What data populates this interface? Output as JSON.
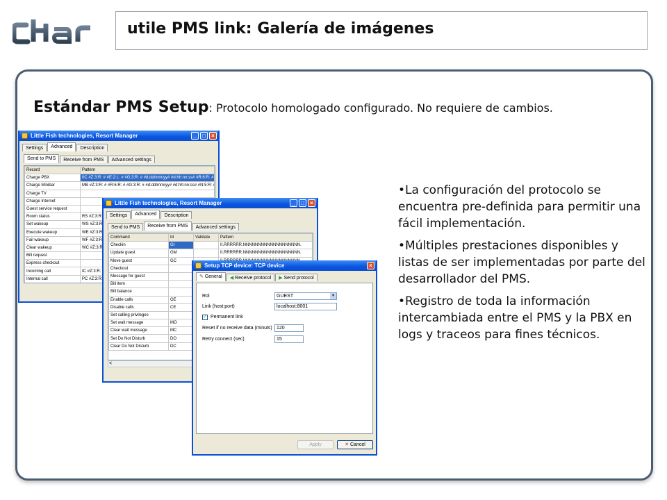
{
  "slide": {
    "title": "utile PMS link: Galería de imágenes",
    "heading_bold": "Estándar PMS Setup",
    "heading_rest": ": Protocolo homologado configurado. No requiere de cambios.",
    "bullets": [
      "•La configuración del protocolo se encuentra pre-definida para permitir una fácil implementación.",
      "•Múltiples prestaciones disponibles y listas de ser implementadas por parte del desarrollador del PMS.",
      "•Registro de toda la información intercambiada entre el PMS y la PBX en logs y traceos para fines técnicos."
    ]
  },
  "win1": {
    "title": "Little Fish technologies, Resort Manager",
    "tabs": [
      "Settings",
      "Advanced",
      "Description"
    ],
    "subtabs": [
      "Send to PMS",
      "Receive from PMS",
      "Advanced settings"
    ],
    "headers": [
      "Record",
      "Pattern"
    ],
    "rows": [
      [
        "Charge PBX",
        "0C #Z:3:R: # #E:2:L: # #G:3:R: # #d:dd/mm/yy# #d:hh:nn:ss# #R:6:R: #"
      ],
      [
        "Charge Minibar",
        "MB #Z:3:R: # #R:6:R: # #G:3:R: # #d:dd/mm/yy# #d:hh:nn:ss# #N:5:R: #"
      ],
      [
        "Charge TV",
        ""
      ],
      [
        "Charge Internet",
        ""
      ],
      [
        "Guest service request",
        ""
      ],
      [
        "Room status",
        "RS #Z:3:R:"
      ],
      [
        "Set wakeup",
        "WS #Z:3:R:"
      ],
      [
        "Execute wakeup",
        "WE #Z:3:R:"
      ],
      [
        "Fail wakeup",
        "WF #Z:3:R:"
      ],
      [
        "Clear wakeup",
        "WC #Z:3:R:"
      ],
      [
        "Bill request",
        ""
      ],
      [
        "Express checkout",
        ""
      ],
      [
        "Incoming call",
        "IC #Z:3:R: #"
      ],
      [
        "Internal call",
        "PC #Z:3:R: #"
      ]
    ]
  },
  "win2": {
    "title": "Little Fish technologies, Resort Manager",
    "tabs": [
      "Settings",
      "Advanced",
      "Description"
    ],
    "subtabs": [
      "Send to PMS",
      "Receive from PMS",
      "Advanced settings"
    ],
    "headers": [
      "Command",
      "Id",
      "Validate",
      "Pattern"
    ],
    "rows": [
      [
        "Checkin",
        "GI",
        "",
        "II.RRRRRR.NNNNNNNNNNNNNNNNNNN."
      ],
      [
        "Update guest",
        "GM",
        "",
        "II.RRRRRR.NNNNNNNNNNNNNNNNNNN."
      ],
      [
        "Move guest",
        "GC",
        "",
        "II.RRRRRR.NNNNNNNNNNNNNNNNNNN."
      ],
      [
        "Checkout",
        "",
        "",
        ""
      ],
      [
        "Message for guest",
        "",
        "",
        ""
      ],
      [
        "Bill item",
        "",
        "",
        ""
      ],
      [
        "Bill balance",
        "",
        "",
        ""
      ],
      [
        "Enable calls",
        "OE",
        "",
        ""
      ],
      [
        "Disable calls",
        "CE",
        "",
        ""
      ],
      [
        "Set calling privileges",
        "",
        "",
        ""
      ],
      [
        "Set wait message",
        "MO",
        "",
        ""
      ],
      [
        "Clear wait message",
        "MC",
        "",
        ""
      ],
      [
        "Set Do Not Disturb",
        "DO",
        "",
        ""
      ],
      [
        "Clear Do Not Disturb",
        "DC",
        "",
        ""
      ]
    ]
  },
  "win3": {
    "title": "Setup TCP device: TCP device",
    "tabs": [
      "General",
      "Receive protocol",
      "Send protocol"
    ],
    "rol_label": "Rol",
    "rol_value": "GUEST",
    "link_label": "Link (host:port)",
    "link_value": "localhost:8001",
    "permanent_label": "Permanent link",
    "reset_label": "Reset if no receive data (minuts)",
    "reset_value": "120",
    "retry_label": "Retry connect (sec)",
    "retry_value": "15",
    "apply_label": "Apply",
    "cancel_label": "Cancel"
  },
  "colors": {
    "panel_border": "#4b5d70",
    "xp_title": "#0a54e0",
    "selection": "#316ac5"
  }
}
